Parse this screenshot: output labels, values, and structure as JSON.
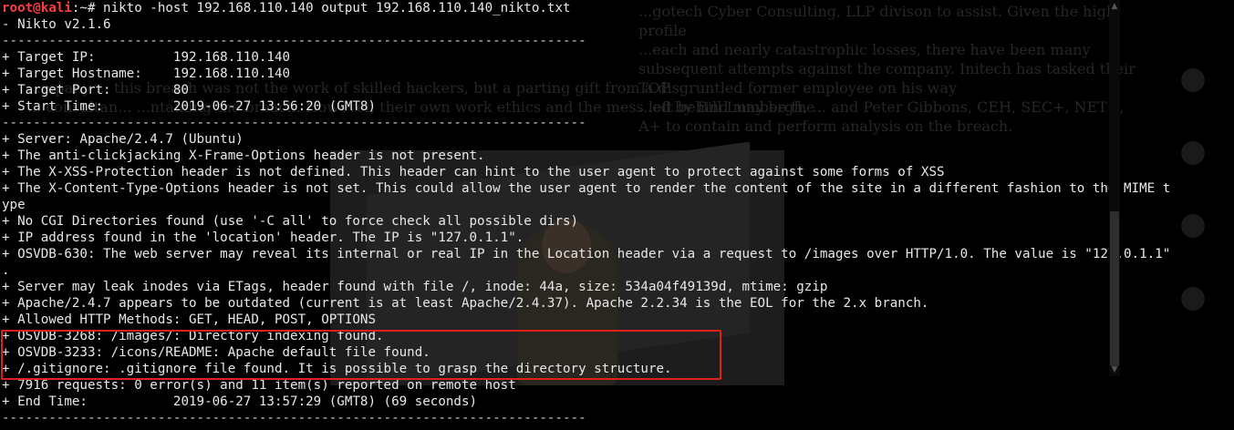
{
  "background": {
    "text_top": "...gotech Cyber Consulting, LLP divison to assist. Given the high profile\n...each and nearly catastrophic losses, there have been many subsequent attempts against the company. Initech has tasked their TOP\n...ed by Bill Lumbergh, ... and Peter Gibbons, CEH, SEC+, NET+, A+ to contain and perform analysis on the breach.",
    "text_mid": "...mpany ... this breach was not the work of skilled hackers, but a parting gift from a disgruntled former employee on his way\n... consultan... ...ntaining the breach. However, their own work ethics and the mess left behind may be the"
  },
  "terminal": {
    "prompt": {
      "user_host": "root@kali",
      "path": ":~#",
      "command": " nikto -host 192.168.110.140 output 192.168.110.140_nikto.txt"
    },
    "lines": [
      "- Nikto v2.1.6",
      "---------------------------------------------------------------------------",
      "+ Target IP:          192.168.110.140",
      "+ Target Hostname:    192.168.110.140",
      "+ Target Port:        80",
      "+ Start Time:         2019-06-27 13:56:20 (GMT8)",
      "---------------------------------------------------------------------------",
      "+ Server: Apache/2.4.7 (Ubuntu)",
      "+ The anti-clickjacking X-Frame-Options header is not present.",
      "+ The X-XSS-Protection header is not defined. This header can hint to the user agent to protect against some forms of XSS",
      "+ The X-Content-Type-Options header is not set. This could allow the user agent to render the content of the site in a different fashion to the MIME t",
      "ype",
      "+ No CGI Directories found (use '-C all' to force check all possible dirs)",
      "+ IP address found in the 'location' header. The IP is \"127.0.1.1\".",
      "+ OSVDB-630: The web server may reveal its internal or real IP in the Location header via a request to /images over HTTP/1.0. The value is \"127.0.1.1\"",
      ".",
      "+ Server may leak inodes via ETags, header found with file /, inode: 44a, size: 534a04f49139d, mtime: gzip",
      "+ Apache/2.4.7 appears to be outdated (current is at least Apache/2.4.37). Apache 2.2.34 is the EOL for the 2.x branch.",
      "+ Allowed HTTP Methods: GET, HEAD, POST, OPTIONS",
      "+ OSVDB-3268: /images/: Directory indexing found.",
      "+ OSVDB-3233: /icons/README: Apache default file found.",
      "+ /.gitignore: .gitignore file found. It is possible to grasp the directory structure.",
      "+ 7916 requests: 0 error(s) and 11 item(s) reported on remote host",
      "+ End Time:           2019-06-27 13:57:29 (GMT8) (69 seconds)",
      "---------------------------------------------------------------------------"
    ]
  },
  "colors": {
    "background": "#000000",
    "text": "#e8e8e8",
    "prompt_user": "#ff3b3b",
    "highlight_border": "#e0201a"
  }
}
